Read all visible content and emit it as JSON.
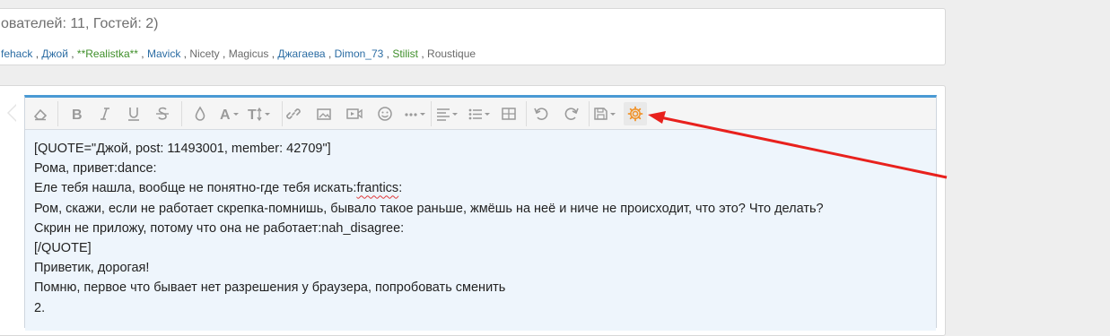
{
  "online": {
    "title": "ователей: 11, Гостей: 2)",
    "users": [
      {
        "name": "fehack",
        "style": "blue"
      },
      {
        "name": "Джой",
        "style": "blue"
      },
      {
        "name": "**Realistka**",
        "style": "green"
      },
      {
        "name": "Mavick",
        "style": "blue"
      },
      {
        "name": "Nicety",
        "style": "gray"
      },
      {
        "name": "Magicus",
        "style": "gray"
      },
      {
        "name": "Джагаева",
        "style": "blue"
      },
      {
        "name": "Dimon_73",
        "style": "blue"
      },
      {
        "name": "Stilist",
        "style": "green"
      },
      {
        "name": "Roustique",
        "style": "gray"
      }
    ],
    "separator": " , "
  },
  "toolbar": {
    "buttons": [
      {
        "icon": "eraser-icon",
        "name": "remove-format-button"
      },
      {
        "icon": "bold-icon",
        "name": "bold-button"
      },
      {
        "icon": "italic-icon",
        "name": "italic-button"
      },
      {
        "icon": "underline-icon",
        "name": "underline-button"
      },
      {
        "icon": "strikethrough-icon",
        "name": "strikethrough-button"
      },
      {
        "icon": "color-drop-icon",
        "name": "text-color-button"
      },
      {
        "icon": "font-family-icon",
        "name": "font-family-button"
      },
      {
        "icon": "font-size-icon",
        "name": "font-size-button"
      },
      {
        "icon": "link-icon",
        "name": "insert-link-button"
      },
      {
        "icon": "image-icon",
        "name": "insert-image-button"
      },
      {
        "icon": "media-icon",
        "name": "insert-media-button"
      },
      {
        "icon": "smiley-icon",
        "name": "insert-smilie-button"
      },
      {
        "icon": "more-icon",
        "name": "more-options-button"
      },
      {
        "icon": "align-icon",
        "name": "align-button"
      },
      {
        "icon": "list-icon",
        "name": "list-button"
      },
      {
        "icon": "table-icon",
        "name": "insert-table-button"
      },
      {
        "icon": "undo-icon",
        "name": "undo-button"
      },
      {
        "icon": "redo-icon",
        "name": "redo-button"
      },
      {
        "icon": "save-draft-icon",
        "name": "drafts-button"
      },
      {
        "icon": "gear-icon",
        "name": "toggle-bbcode-button"
      }
    ],
    "active_color": "#f0932b",
    "accent_color": "#4a9ad4"
  },
  "editor": {
    "lines": [
      "[QUOTE=\"Джой, post: 11493001, member: 42709\"]",
      "Рома, привет:dance:",
      "Еле тебя нашла, вообще не понятно-где тебя искать:",
      "Ром, скажи, если не работает скрепка-помнишь, бывало такое раньше, жмёшь на неё и ниче не происходит, что это? Что делать?",
      "Скрин не приложу, потому что она не работает:nah_disagree:",
      "[/QUOTE]",
      "Приветик, дорогая!",
      "Помню, первое что бывает нет разрешения у браузера, попробовать сменить",
      "2."
    ],
    "misspelled_word": "frantics",
    "misspelled_suffix": ":",
    "background": "#eef5fc"
  },
  "annotation": {
    "arrow_color": "#e8211d"
  }
}
